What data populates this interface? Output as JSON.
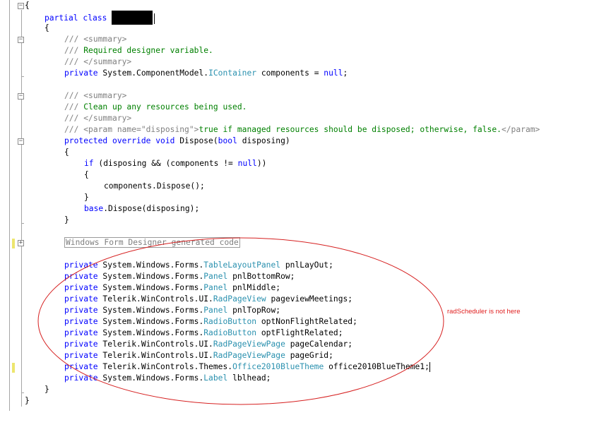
{
  "editor": {
    "lines": [
      {
        "id": "open-brace-outer",
        "tokens": [
          {
            "t": "{",
            "c": "plain"
          }
        ]
      },
      {
        "id": "partial-class",
        "tokens": [
          {
            "t": "partial class ",
            "c": "kw"
          }
        ],
        "redacted": true
      },
      {
        "id": "open-brace-class",
        "tokens": [
          {
            "t": "{",
            "c": "plain"
          }
        ]
      },
      {
        "id": "summary-open-1",
        "tokens": [
          {
            "t": "/// ",
            "c": "dc"
          },
          {
            "t": "<summary>",
            "c": "dc"
          }
        ]
      },
      {
        "id": "summary-text-1",
        "tokens": [
          {
            "t": "/// ",
            "c": "dc"
          },
          {
            "t": "Required designer variable.",
            "c": "cm"
          }
        ]
      },
      {
        "id": "summary-close-1",
        "tokens": [
          {
            "t": "/// ",
            "c": "dc"
          },
          {
            "t": "</summary>",
            "c": "dc"
          }
        ]
      },
      {
        "id": "components-field",
        "tokens": [
          {
            "t": "private ",
            "c": "kw"
          },
          {
            "t": "System.ComponentModel.",
            "c": "plain"
          },
          {
            "t": "IContainer",
            "c": "ty"
          },
          {
            "t": " components = ",
            "c": "plain"
          },
          {
            "t": "null",
            "c": "kw"
          },
          {
            "t": ";",
            "c": "plain"
          }
        ]
      },
      {
        "id": "blank-1",
        "tokens": []
      },
      {
        "id": "summary-open-2",
        "tokens": [
          {
            "t": "/// ",
            "c": "dc"
          },
          {
            "t": "<summary>",
            "c": "dc"
          }
        ]
      },
      {
        "id": "summary-text-2",
        "tokens": [
          {
            "t": "/// ",
            "c": "dc"
          },
          {
            "t": "Clean up any resources being used.",
            "c": "cm"
          }
        ]
      },
      {
        "id": "summary-close-2",
        "tokens": [
          {
            "t": "/// ",
            "c": "dc"
          },
          {
            "t": "</summary>",
            "c": "dc"
          }
        ]
      },
      {
        "id": "param-doc",
        "tokens": [
          {
            "t": "/// ",
            "c": "dc"
          },
          {
            "t": "<param name=\"disposing\">",
            "c": "dc"
          },
          {
            "t": "true if managed resources should be disposed; otherwise, false.",
            "c": "cm"
          },
          {
            "t": "</param>",
            "c": "dc"
          }
        ]
      },
      {
        "id": "dispose-signature",
        "tokens": [
          {
            "t": "protected ",
            "c": "kw"
          },
          {
            "t": "override ",
            "c": "kw"
          },
          {
            "t": "void ",
            "c": "kw"
          },
          {
            "t": "Dispose(",
            "c": "plain"
          },
          {
            "t": "bool",
            "c": "kw"
          },
          {
            "t": " disposing)",
            "c": "plain"
          }
        ]
      },
      {
        "id": "dispose-open",
        "tokens": [
          {
            "t": "{",
            "c": "plain"
          }
        ]
      },
      {
        "id": "if-line",
        "tokens": [
          {
            "t": "if",
            "c": "kw"
          },
          {
            "t": " (disposing && (components != ",
            "c": "plain"
          },
          {
            "t": "null",
            "c": "kw"
          },
          {
            "t": "))",
            "c": "plain"
          }
        ]
      },
      {
        "id": "if-open",
        "tokens": [
          {
            "t": "{",
            "c": "plain"
          }
        ]
      },
      {
        "id": "components-dispose",
        "tokens": [
          {
            "t": "components.Dispose();",
            "c": "plain"
          }
        ]
      },
      {
        "id": "if-close",
        "tokens": [
          {
            "t": "}",
            "c": "plain"
          }
        ]
      },
      {
        "id": "base-dispose",
        "tokens": [
          {
            "t": "base",
            "c": "kw"
          },
          {
            "t": ".Dispose(disposing);",
            "c": "plain"
          }
        ]
      },
      {
        "id": "dispose-close",
        "tokens": [
          {
            "t": "}",
            "c": "plain"
          }
        ]
      },
      {
        "id": "blank-2",
        "tokens": []
      },
      {
        "id": "designer-region",
        "tokens": [],
        "region": "Windows Form Designer generated code"
      },
      {
        "id": "blank-3",
        "tokens": []
      },
      {
        "id": "field-pnlLayOut",
        "tokens": [
          {
            "t": "private ",
            "c": "kw"
          },
          {
            "t": "System.Windows.Forms.",
            "c": "plain"
          },
          {
            "t": "TableLayoutPanel",
            "c": "ty"
          },
          {
            "t": " pnlLayOut;",
            "c": "plain"
          }
        ]
      },
      {
        "id": "field-pnlBottomRow",
        "tokens": [
          {
            "t": "private ",
            "c": "kw"
          },
          {
            "t": "System.Windows.Forms.",
            "c": "plain"
          },
          {
            "t": "Panel",
            "c": "ty"
          },
          {
            "t": " pnlBottomRow;",
            "c": "plain"
          }
        ]
      },
      {
        "id": "field-pnlMiddle",
        "tokens": [
          {
            "t": "private ",
            "c": "kw"
          },
          {
            "t": "System.Windows.Forms.",
            "c": "plain"
          },
          {
            "t": "Panel",
            "c": "ty"
          },
          {
            "t": " pnlMiddle;",
            "c": "plain"
          }
        ]
      },
      {
        "id": "field-pageviewMeetings",
        "tokens": [
          {
            "t": "private ",
            "c": "kw"
          },
          {
            "t": "Telerik.WinControls.UI.",
            "c": "plain"
          },
          {
            "t": "RadPageView",
            "c": "ty"
          },
          {
            "t": " pageviewMeetings;",
            "c": "plain"
          }
        ]
      },
      {
        "id": "field-pnlTopRow",
        "tokens": [
          {
            "t": "private ",
            "c": "kw"
          },
          {
            "t": "System.Windows.Forms.",
            "c": "plain"
          },
          {
            "t": "Panel",
            "c": "ty"
          },
          {
            "t": " pnlTopRow;",
            "c": "plain"
          }
        ]
      },
      {
        "id": "field-optNonFlightRelated",
        "tokens": [
          {
            "t": "private ",
            "c": "kw"
          },
          {
            "t": "System.Windows.Forms.",
            "c": "plain"
          },
          {
            "t": "RadioButton",
            "c": "ty"
          },
          {
            "t": " optNonFlightRelated;",
            "c": "plain"
          }
        ]
      },
      {
        "id": "field-optFlightRelated",
        "tokens": [
          {
            "t": "private ",
            "c": "kw"
          },
          {
            "t": "System.Windows.Forms.",
            "c": "plain"
          },
          {
            "t": "RadioButton",
            "c": "ty"
          },
          {
            "t": " optFlightRelated;",
            "c": "plain"
          }
        ]
      },
      {
        "id": "field-pageCalendar",
        "tokens": [
          {
            "t": "private ",
            "c": "kw"
          },
          {
            "t": "Telerik.WinControls.UI.",
            "c": "plain"
          },
          {
            "t": "RadPageViewPage",
            "c": "ty"
          },
          {
            "t": " pageCalendar;",
            "c": "plain"
          }
        ]
      },
      {
        "id": "field-pageGrid",
        "tokens": [
          {
            "t": "private ",
            "c": "kw"
          },
          {
            "t": "Telerik.WinControls.UI.",
            "c": "plain"
          },
          {
            "t": "RadPageViewPage",
            "c": "ty"
          },
          {
            "t": " pageGrid;",
            "c": "plain"
          }
        ]
      },
      {
        "id": "field-office2010BlueTheme1",
        "tokens": [
          {
            "t": "private ",
            "c": "kw"
          },
          {
            "t": "Telerik.WinControls.Themes.",
            "c": "plain"
          },
          {
            "t": "Office2010BlueTheme",
            "c": "ty"
          },
          {
            "t": " office2010BlueTheme1;",
            "c": "plain"
          }
        ],
        "caret": true
      },
      {
        "id": "field-lblhead",
        "tokens": [
          {
            "t": "private ",
            "c": "kw"
          },
          {
            "t": "System.Windows.Forms.",
            "c": "plain"
          },
          {
            "t": "Label",
            "c": "ty"
          },
          {
            "t": " lblhead;",
            "c": "plain"
          }
        ]
      },
      {
        "id": "close-brace-class",
        "tokens": [
          {
            "t": "}",
            "c": "plain"
          }
        ]
      },
      {
        "id": "close-brace-outer",
        "tokens": [
          {
            "t": "}",
            "c": "plain"
          }
        ]
      }
    ]
  },
  "annotation": {
    "text": "radScheduler is not here",
    "color": "#e02020"
  },
  "colors": {
    "keyword": "#0000ff",
    "type": "#2b91af",
    "comment": "#008000",
    "doc_tag": "#808080",
    "change_marker": "#ede66e"
  }
}
